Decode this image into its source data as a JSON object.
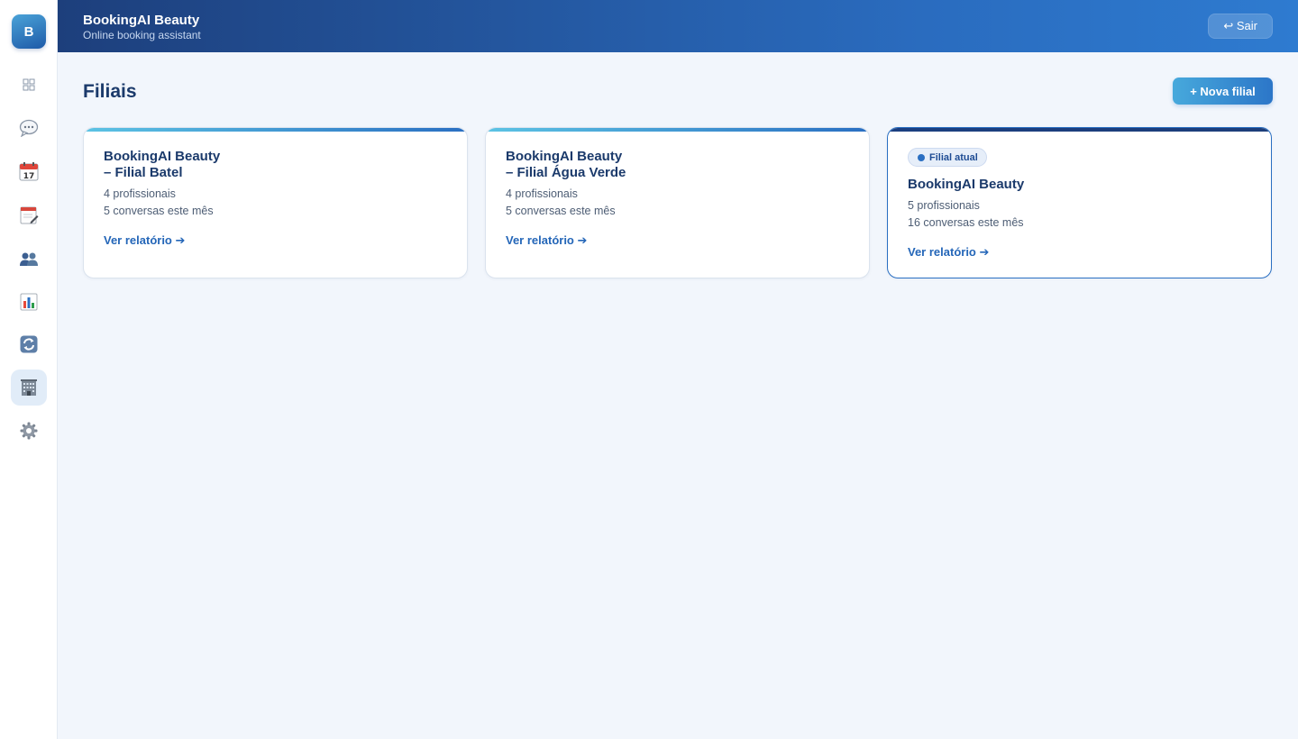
{
  "sidebar": {
    "logo_letter": "B",
    "items": [
      {
        "icon": "grid-icon",
        "active": false
      },
      {
        "icon": "chat-bubble-icon",
        "active": false
      },
      {
        "icon": "calendar-icon",
        "active": false
      },
      {
        "icon": "notepad-icon",
        "active": false
      },
      {
        "icon": "users-icon",
        "active": false
      },
      {
        "icon": "bar-chart-icon",
        "active": false
      },
      {
        "icon": "refresh-icon",
        "active": false
      },
      {
        "icon": "office-building-icon",
        "active": true
      },
      {
        "icon": "gear-icon",
        "active": false
      }
    ]
  },
  "header": {
    "title": "BookingAI Beauty",
    "subtitle": "Online booking assistant",
    "logout_label": "↩ Sair"
  },
  "page": {
    "title": "Filiais",
    "new_branch_label": "+ Nova filial"
  },
  "branches": [
    {
      "name_line1": "BookingAI Beauty",
      "name_line2": "– Filial Batel",
      "professionals": "4 profissionais",
      "conversations": "5 conversas este mês",
      "link": "Ver relatório ➔",
      "current": false
    },
    {
      "name_line1": "BookingAI Beauty",
      "name_line2": "– Filial Água Verde",
      "professionals": "4 profissionais",
      "conversations": "5 conversas este mês",
      "link": "Ver relatório ➔",
      "current": false
    },
    {
      "badge": "Filial atual",
      "name_line1": "BookingAI Beauty",
      "professionals": "5 profissionais",
      "conversations": "16 conversas este mês",
      "link": "Ver relatório ➔",
      "current": true
    }
  ],
  "colors": {
    "header_gradient_start": "#1d3f7c",
    "header_gradient_end": "#2e7bd0",
    "accent": "#2466b8",
    "background": "#f2f6fc"
  }
}
